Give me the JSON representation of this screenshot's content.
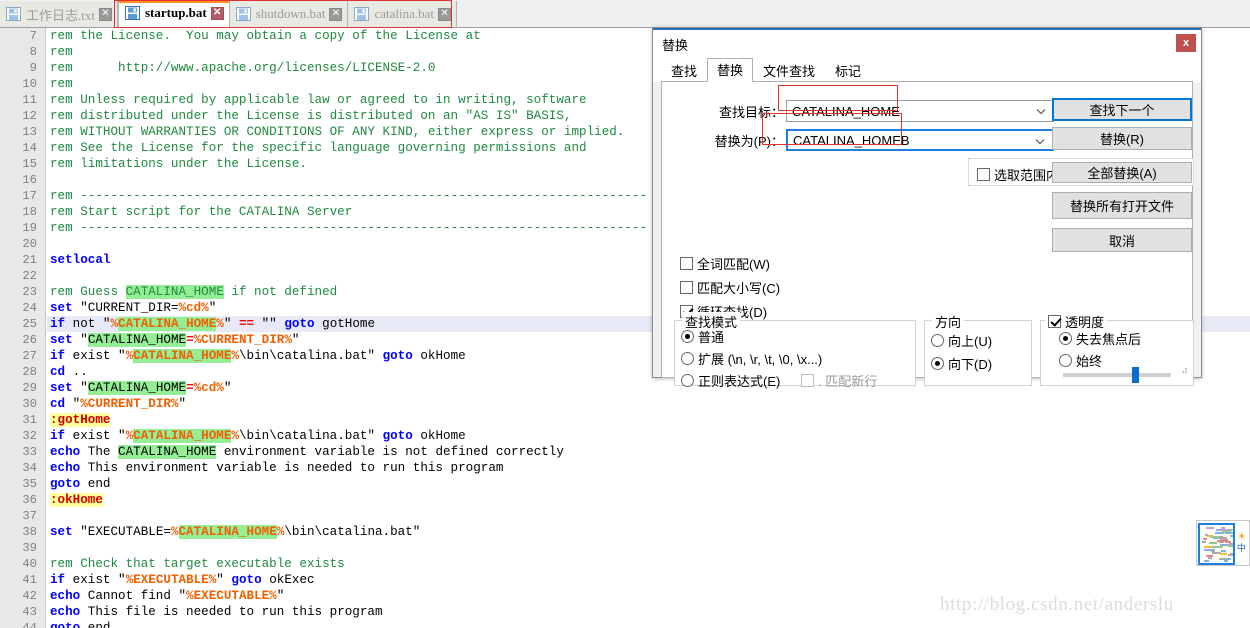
{
  "tabs": [
    {
      "label": "工作日志.txt",
      "icon": "floppy-disk-icon",
      "active": false,
      "close": "✕"
    },
    {
      "label": "startup.bat",
      "icon": "floppy-disk-icon",
      "active": true,
      "close": "✕"
    },
    {
      "label": "shutdown.bat",
      "icon": "floppy-disk-icon",
      "active": false,
      "close": "✕"
    },
    {
      "label": "catalina.bat",
      "icon": "floppy-disk-icon",
      "active": false,
      "close": "✕"
    }
  ],
  "editor": {
    "current_line": 25,
    "first_visible_line": 7,
    "lines": [
      {
        "n": 7,
        "segs": [
          {
            "t": "rem the License.  You may obtain a copy of the License at",
            "c": "c-rem"
          }
        ]
      },
      {
        "n": 8,
        "segs": [
          {
            "t": "rem",
            "c": "c-rem"
          }
        ]
      },
      {
        "n": 9,
        "segs": [
          {
            "t": "rem      http://www.apache.org/licenses/LICENSE-2.0",
            "c": "c-rem"
          }
        ]
      },
      {
        "n": 10,
        "segs": [
          {
            "t": "rem",
            "c": "c-rem"
          }
        ]
      },
      {
        "n": 11,
        "segs": [
          {
            "t": "rem Unless required by applicable law or agreed to in writing, software",
            "c": "c-rem"
          }
        ]
      },
      {
        "n": 12,
        "segs": [
          {
            "t": "rem distributed under the License is distributed on an \"AS IS\" BASIS,",
            "c": "c-rem"
          }
        ]
      },
      {
        "n": 13,
        "segs": [
          {
            "t": "rem WITHOUT WARRANTIES OR CONDITIONS OF ANY KIND, either express or implied.",
            "c": "c-rem"
          }
        ]
      },
      {
        "n": 14,
        "segs": [
          {
            "t": "rem See the License for the specific language governing permissions and",
            "c": "c-rem"
          }
        ]
      },
      {
        "n": 15,
        "segs": [
          {
            "t": "rem limitations under the License.",
            "c": "c-rem"
          }
        ]
      },
      {
        "n": 16,
        "segs": []
      },
      {
        "n": 17,
        "segs": [
          {
            "t": "rem ---------------------------------------------------------------------------",
            "c": "c-rem"
          }
        ]
      },
      {
        "n": 18,
        "segs": [
          {
            "t": "rem Start script for the CATALINA Server",
            "c": "c-rem"
          }
        ]
      },
      {
        "n": 19,
        "segs": [
          {
            "t": "rem ---------------------------------------------------------------------------",
            "c": "c-rem"
          }
        ]
      },
      {
        "n": 20,
        "segs": []
      },
      {
        "n": 21,
        "segs": [
          {
            "t": "setlocal",
            "c": "c-kw"
          }
        ]
      },
      {
        "n": 22,
        "segs": []
      },
      {
        "n": 23,
        "segs": [
          {
            "t": "rem Guess ",
            "c": "c-rem"
          },
          {
            "t": "CATALINA_HOME",
            "c": "c-rem hl"
          },
          {
            "t": " if not defined",
            "c": "c-rem"
          }
        ]
      },
      {
        "n": 24,
        "segs": [
          {
            "t": "set",
            "c": "c-kw"
          },
          {
            "t": " \"CURRENT_DIR=",
            "c": "c-str"
          },
          {
            "t": "%cd%",
            "c": "c-var"
          },
          {
            "t": "\"",
            "c": "c-str"
          }
        ]
      },
      {
        "n": 25,
        "segs": [
          {
            "t": "if",
            "c": "c-kw"
          },
          {
            "t": " not \"",
            "c": "c-str"
          },
          {
            "t": "%",
            "c": "c-var"
          },
          {
            "t": "CATALINA_HOME",
            "c": "hl-var"
          },
          {
            "t": "%",
            "c": "c-var"
          },
          {
            "t": "\" ",
            "c": "c-str"
          },
          {
            "t": "==",
            "c": "c-op"
          },
          {
            "t": " \"\" ",
            "c": "c-str"
          },
          {
            "t": "goto",
            "c": "c-kw"
          },
          {
            "t": " gotHome",
            "c": "c-plain"
          }
        ]
      },
      {
        "n": 26,
        "segs": [
          {
            "t": "set",
            "c": "c-kw"
          },
          {
            "t": " \"",
            "c": "c-str"
          },
          {
            "t": "CATALINA_HOME",
            "c": "hl"
          },
          {
            "t": "=",
            "c": "c-op"
          },
          {
            "t": "%CURRENT_DIR%",
            "c": "c-var"
          },
          {
            "t": "\"",
            "c": "c-str"
          }
        ]
      },
      {
        "n": 27,
        "segs": [
          {
            "t": "if",
            "c": "c-kw"
          },
          {
            "t": " exist \"",
            "c": "c-str"
          },
          {
            "t": "%",
            "c": "c-var"
          },
          {
            "t": "CATALINA_HOME",
            "c": "hl-var"
          },
          {
            "t": "%",
            "c": "c-var"
          },
          {
            "t": "\\bin\\catalina.bat\" ",
            "c": "c-str"
          },
          {
            "t": "goto",
            "c": "c-kw"
          },
          {
            "t": " okHome",
            "c": "c-plain"
          }
        ]
      },
      {
        "n": 28,
        "segs": [
          {
            "t": "cd",
            "c": "c-kw"
          },
          {
            "t": " ..",
            "c": "c-plain"
          }
        ]
      },
      {
        "n": 29,
        "segs": [
          {
            "t": "set",
            "c": "c-kw"
          },
          {
            "t": " \"",
            "c": "c-str"
          },
          {
            "t": "CATALINA_HOME",
            "c": "hl"
          },
          {
            "t": "=",
            "c": "c-op"
          },
          {
            "t": "%cd%",
            "c": "c-var"
          },
          {
            "t": "\"",
            "c": "c-str"
          }
        ]
      },
      {
        "n": 30,
        "segs": [
          {
            "t": "cd",
            "c": "c-kw"
          },
          {
            "t": " \"",
            "c": "c-str"
          },
          {
            "t": "%CURRENT_DIR%",
            "c": "c-var"
          },
          {
            "t": "\"",
            "c": "c-str"
          }
        ]
      },
      {
        "n": 31,
        "segs": [
          {
            "t": ":gotHome",
            "c": "c-lbl"
          }
        ]
      },
      {
        "n": 32,
        "segs": [
          {
            "t": "if",
            "c": "c-kw"
          },
          {
            "t": " exist \"",
            "c": "c-str"
          },
          {
            "t": "%",
            "c": "c-var"
          },
          {
            "t": "CATALINA_HOME",
            "c": "hl-var"
          },
          {
            "t": "%",
            "c": "c-var"
          },
          {
            "t": "\\bin\\catalina.bat\" ",
            "c": "c-str"
          },
          {
            "t": "goto",
            "c": "c-kw"
          },
          {
            "t": " okHome",
            "c": "c-plain"
          }
        ]
      },
      {
        "n": 33,
        "segs": [
          {
            "t": "echo",
            "c": "c-kw"
          },
          {
            "t": " The ",
            "c": "c-plain"
          },
          {
            "t": "CATALINA_HOME",
            "c": "hl"
          },
          {
            "t": " environment variable is not defined correctly",
            "c": "c-plain"
          }
        ]
      },
      {
        "n": 34,
        "segs": [
          {
            "t": "echo",
            "c": "c-kw"
          },
          {
            "t": " This environment variable is needed to run this program",
            "c": "c-plain"
          }
        ]
      },
      {
        "n": 35,
        "segs": [
          {
            "t": "goto",
            "c": "c-kw"
          },
          {
            "t": " end",
            "c": "c-plain"
          }
        ]
      },
      {
        "n": 36,
        "segs": [
          {
            "t": ":okHome",
            "c": "c-lbl"
          }
        ]
      },
      {
        "n": 37,
        "segs": []
      },
      {
        "n": 38,
        "segs": [
          {
            "t": "set",
            "c": "c-kw"
          },
          {
            "t": " \"EXECUTABLE=",
            "c": "c-str"
          },
          {
            "t": "%",
            "c": "c-var"
          },
          {
            "t": "CATALINA_HOME",
            "c": "hl-var"
          },
          {
            "t": "%",
            "c": "c-var"
          },
          {
            "t": "\\bin\\catalina.bat\"",
            "c": "c-str"
          }
        ]
      },
      {
        "n": 39,
        "segs": []
      },
      {
        "n": 40,
        "segs": [
          {
            "t": "rem Check that target executable exists",
            "c": "c-rem"
          }
        ]
      },
      {
        "n": 41,
        "segs": [
          {
            "t": "if",
            "c": "c-kw"
          },
          {
            "t": " exist \"",
            "c": "c-str"
          },
          {
            "t": "%EXECUTABLE%",
            "c": "c-var"
          },
          {
            "t": "\" ",
            "c": "c-str"
          },
          {
            "t": "goto",
            "c": "c-kw"
          },
          {
            "t": " okExec",
            "c": "c-plain"
          }
        ]
      },
      {
        "n": 42,
        "segs": [
          {
            "t": "echo",
            "c": "c-kw"
          },
          {
            "t": " Cannot find \"",
            "c": "c-plain"
          },
          {
            "t": "%EXECUTABLE%",
            "c": "c-var"
          },
          {
            "t": "\"",
            "c": "c-plain"
          }
        ]
      },
      {
        "n": 43,
        "segs": [
          {
            "t": "echo",
            "c": "c-kw"
          },
          {
            "t": " This file is needed to run this program",
            "c": "c-plain"
          }
        ]
      },
      {
        "n": 44,
        "segs": [
          {
            "t": "goto",
            "c": "c-kw"
          },
          {
            "t": " end",
            "c": "c-plain"
          }
        ]
      }
    ]
  },
  "dialog": {
    "title": "替换",
    "close_label": "x",
    "tabs": [
      {
        "label": "查找",
        "active": false
      },
      {
        "label": "替换",
        "active": true
      },
      {
        "label": "文件查找",
        "active": false
      },
      {
        "label": "标记",
        "active": false
      }
    ],
    "find_label": "查找目标：",
    "find_value": "CATALINA_HOME",
    "replace_label": "替换为(P)：",
    "replace_value": "CATALINA_HOMEB",
    "in_selection_label": "选取范围内",
    "in_selection_checked": false,
    "buttons": {
      "find_next": "查找下一个",
      "replace": "替换(R)",
      "replace_all": "全部替换(A)",
      "replace_all_open": "替换所有打开文件",
      "cancel": "取消"
    },
    "options": [
      {
        "label": "全词匹配(W)",
        "checked": false
      },
      {
        "label": "匹配大小写(C)",
        "checked": false
      },
      {
        "label": "循环查找(D)",
        "checked": true
      }
    ],
    "search_mode": {
      "title": "查找模式",
      "items": [
        {
          "label": "普通",
          "checked": true
        },
        {
          "label": "扩展 (\\n, \\r, \\t, \\0, \\x...)",
          "checked": false
        },
        {
          "label": "正则表达式(E)",
          "checked": false
        }
      ],
      "newline_label": ". 匹配新行",
      "newline_checked": false
    },
    "direction": {
      "title": "方向",
      "items": [
        {
          "label": "向上(U)",
          "checked": false
        },
        {
          "label": "向下(D)",
          "checked": true
        }
      ]
    },
    "transparency": {
      "title": "透明度",
      "checked": true,
      "items": [
        {
          "label": "失去焦点后",
          "checked": true
        },
        {
          "label": "始终",
          "checked": false
        }
      ],
      "slider_percent": 68
    }
  },
  "watermark": "http://blog.csdn.net/anderslu",
  "thumb_widget": {
    "sun_icon": "sun-icon",
    "label": "中"
  },
  "colors": {
    "accent_orange": "#ff8c21",
    "accent_blue": "#0078d7",
    "close_red": "#c0504d",
    "annotation_red": "#e03030",
    "highlight_green": "#95ee95",
    "label_yellow": "#ffff9e",
    "comment_green": "#1f8a3f",
    "keyword_blue": "#0000ff",
    "variable_orange": "#f06000"
  }
}
